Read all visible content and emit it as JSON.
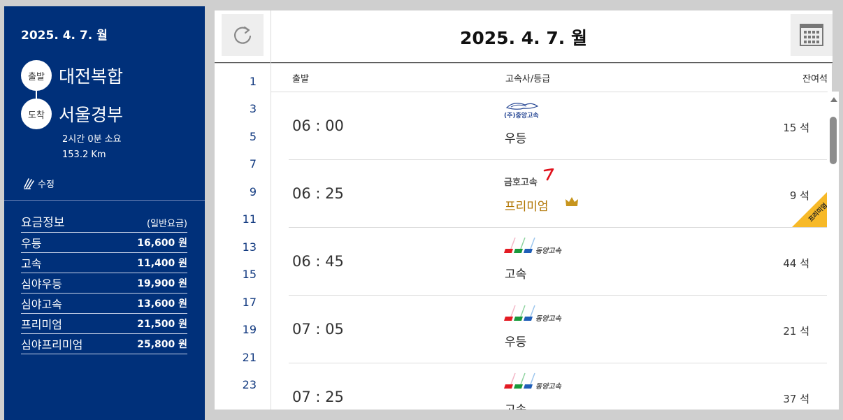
{
  "sidebar": {
    "date": "2025. 4. 7. 월",
    "departure": {
      "badge": "출발",
      "name": "대전복합"
    },
    "arrival": {
      "badge": "도착",
      "name": "서울경부"
    },
    "duration": "2시간 0분 소요",
    "distance": "153.2 Km",
    "edit_label": "수정",
    "fare_title": "요금정보",
    "fare_subtitle": "(일반요금)",
    "fares": [
      {
        "grade": "우등",
        "price": "16,600 원"
      },
      {
        "grade": "고속",
        "price": "11,400 원"
      },
      {
        "grade": "심야우등",
        "price": "19,900 원"
      },
      {
        "grade": "심야고속",
        "price": "13,600 원"
      },
      {
        "grade": "프리미엄",
        "price": "21,500 원"
      },
      {
        "grade": "심야프리미엄",
        "price": "25,800 원"
      }
    ]
  },
  "topbar": {
    "title": "2025. 4. 7. 월",
    "refresh_icon": "refresh-icon",
    "calendar_icon": "calendar-icon"
  },
  "hours": [
    "1",
    "3",
    "5",
    "7",
    "9",
    "11",
    "13",
    "15",
    "17",
    "19",
    "21",
    "23"
  ],
  "list": {
    "headers": {
      "departure": "출발",
      "company": "고속사/등급",
      "seats": "잔여석"
    },
    "rows": [
      {
        "time": "06 : 00",
        "company_logo": "(주)중앙고속",
        "grade": "우등",
        "seats": "15 석",
        "premium": false
      },
      {
        "time": "06 : 25",
        "company_logo": "금호고속",
        "grade": "프리미엄",
        "seats": "9 석",
        "premium": true,
        "ribbon": "프리미엄"
      },
      {
        "time": "06 : 45",
        "company_logo": "동양고속",
        "grade": "고속",
        "seats": "44 석",
        "premium": false
      },
      {
        "time": "07 : 05",
        "company_logo": "동양고속",
        "grade": "우등",
        "seats": "21 석",
        "premium": false
      },
      {
        "time": "07 : 25",
        "company_logo": "동양고속",
        "grade": "고속",
        "seats": "37 석",
        "premium": false
      }
    ]
  },
  "colors": {
    "sidebar_bg": "#00307a",
    "premium": "#b07400",
    "ribbon": "#f7b928",
    "hour_text": "#123a80"
  }
}
